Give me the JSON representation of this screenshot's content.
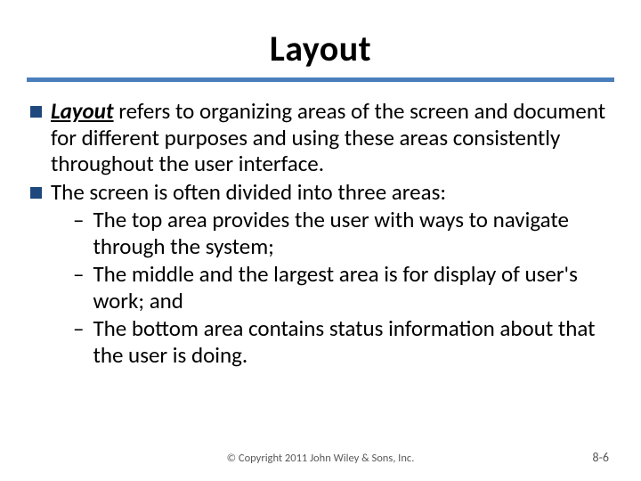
{
  "slide": {
    "title": "Layout",
    "bullets": [
      {
        "term": "Layout",
        "rest": " refers to organizing areas of the screen and document for different purposes and using these areas consistently throughout the user interface."
      },
      {
        "text": "The screen is often divided into three areas:",
        "sub": [
          "The top area provides the user with ways to navigate through the system;",
          "The middle and the largest area is for display of user's work; and",
          "The bottom area contains status information about that the user is doing."
        ]
      }
    ],
    "copyright": "© Copyright 2011 John Wiley & Sons, Inc.",
    "page": "8-6"
  }
}
